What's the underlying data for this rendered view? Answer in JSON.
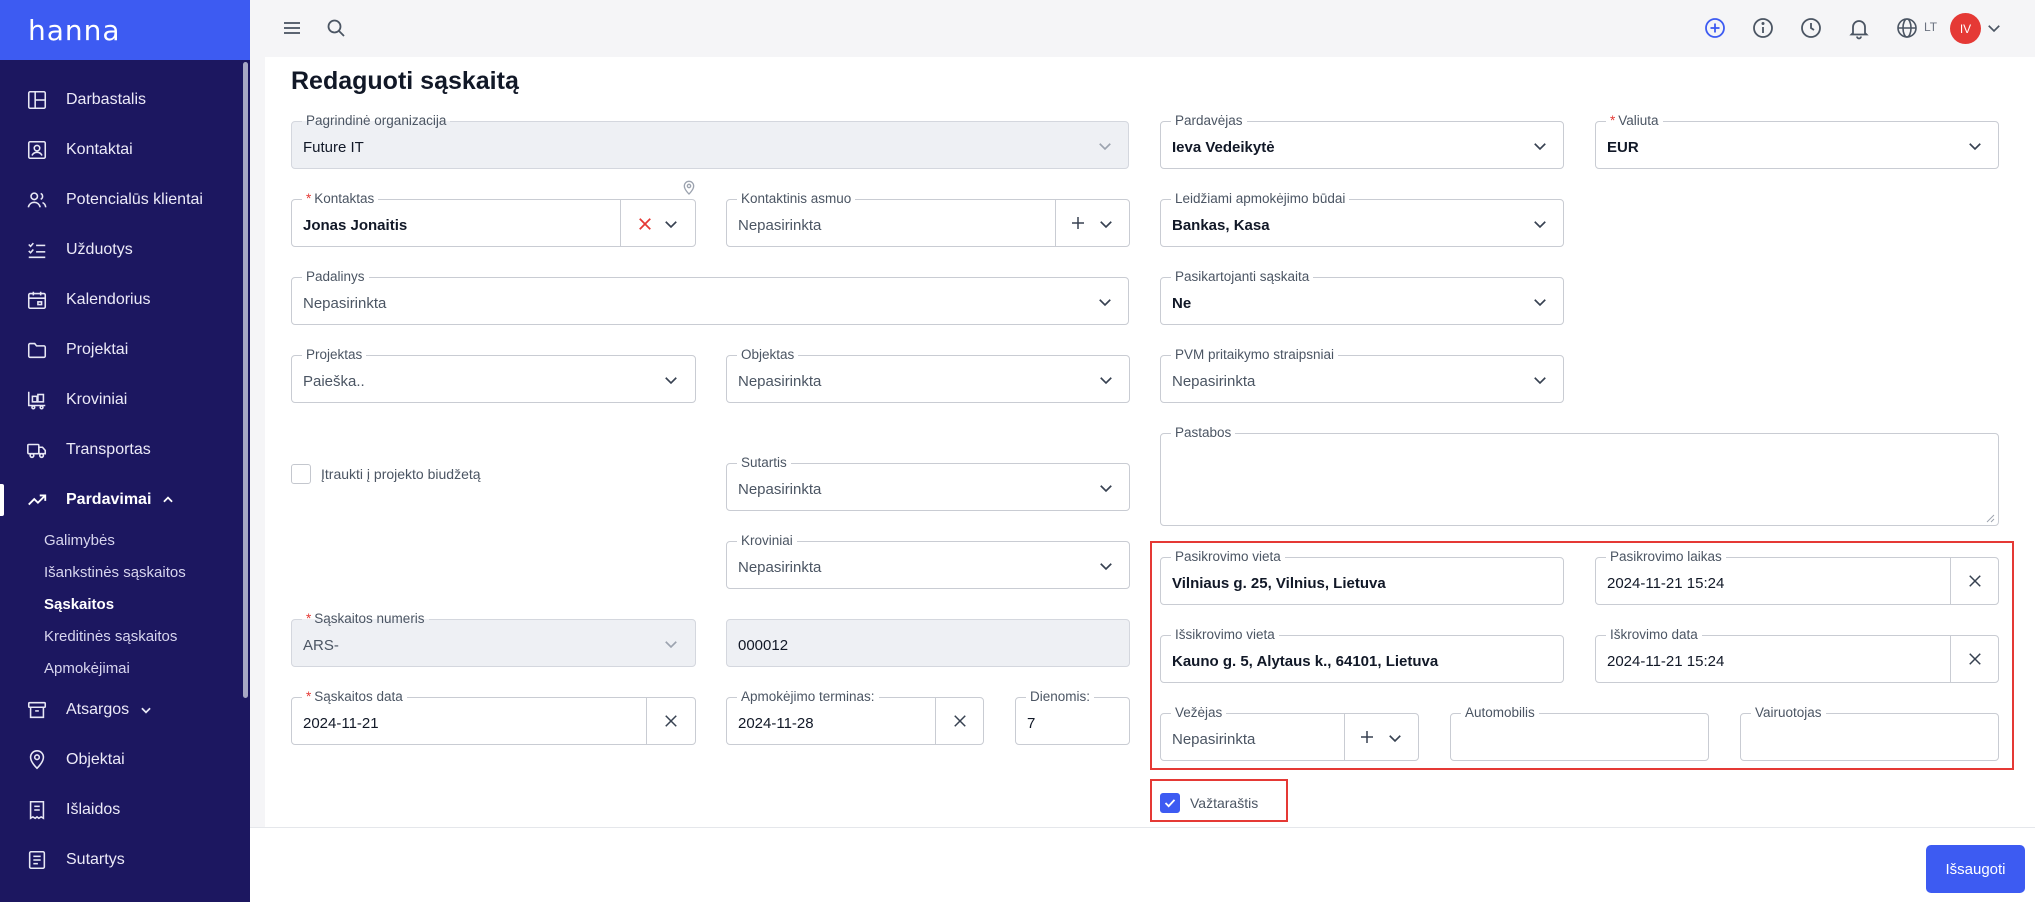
{
  "app": {
    "logo": "hanna"
  },
  "sidebar": {
    "items": [
      {
        "label": "Darbastalis",
        "icon": "dashboard-icon"
      },
      {
        "label": "Kontaktai",
        "icon": "contacts-icon"
      },
      {
        "label": "Potencialūs klientai",
        "icon": "leads-icon"
      },
      {
        "label": "Užduotys",
        "icon": "tasks-icon"
      },
      {
        "label": "Kalendorius",
        "icon": "calendar-icon"
      },
      {
        "label": "Projektai",
        "icon": "folder-icon"
      },
      {
        "label": "Kroviniai",
        "icon": "cargo-icon"
      },
      {
        "label": "Transportas",
        "icon": "truck-icon"
      },
      {
        "label": "Pardavimai",
        "icon": "sales-trend-icon"
      },
      {
        "label": "Atsargos",
        "icon": "box-icon"
      },
      {
        "label": "Objektai",
        "icon": "location-pin-icon"
      },
      {
        "label": "Išlaidos",
        "icon": "receipt-icon"
      },
      {
        "label": "Sutartys",
        "icon": "contract-icon"
      }
    ],
    "sales_sub": [
      "Galimybės",
      "Išankstinės sąskaitos",
      "Sąskaitos",
      "Kreditinės sąskaitos",
      "Apmokėjimai"
    ]
  },
  "topbar": {
    "lang": "LT",
    "avatar_initials": "IV"
  },
  "page": {
    "title": "Redaguoti sąskaitą"
  },
  "form": {
    "parent_org": {
      "label": "Pagrindinė organizacija",
      "value": "Future IT"
    },
    "contact": {
      "label": "Kontaktas",
      "value": "Jonas Jonaitis"
    },
    "contact_person": {
      "label": "Kontaktinis asmuo",
      "value": "Nepasirinkta"
    },
    "division": {
      "label": "Padalinys",
      "value": "Nepasirinkta"
    },
    "project": {
      "label": "Projektas",
      "value": "Paieška.."
    },
    "object": {
      "label": "Objektas",
      "value": "Nepasirinkta"
    },
    "include_budget": {
      "label": "Įtraukti į projekto biudžetą",
      "checked": false
    },
    "contract": {
      "label": "Sutartis",
      "value": "Nepasirinkta"
    },
    "cargo": {
      "label": "Kroviniai",
      "value": "Nepasirinkta"
    },
    "invoice_number": {
      "label": "Sąskaitos numeris",
      "prefix": "ARS-",
      "number": "000012"
    },
    "invoice_date": {
      "label": "Sąskaitos data",
      "value": "2024-11-21"
    },
    "payment_term": {
      "label": "Apmokėjimo terminas:",
      "value": "2024-11-28"
    },
    "days": {
      "label": "Dienomis:",
      "value": "7"
    },
    "seller": {
      "label": "Pardavėjas",
      "value": "Ieva Vedeikytė"
    },
    "currency": {
      "label": "Valiuta",
      "value": "EUR"
    },
    "payment_methods": {
      "label": "Leidžiami apmokėjimo būdai",
      "value": "Bankas, Kasa"
    },
    "recurring": {
      "label": "Pasikartojanti sąskaita",
      "value": "Ne"
    },
    "vat_articles": {
      "label": "PVM pritaikymo straipsniai",
      "value": "Nepasirinkta"
    },
    "notes": {
      "label": "Pastabos",
      "value": ""
    },
    "loading_place": {
      "label": "Pasikrovimo vieta",
      "value": "Vilniaus g. 25, Vilnius, Lietuva"
    },
    "loading_time": {
      "label": "Pasikrovimo laikas",
      "value": "2024-11-21 15:24"
    },
    "unloading_place": {
      "label": "Išsikrovimo vieta",
      "value": "Kauno g. 5, Alytaus k., 64101, Lietuva"
    },
    "unloading_date": {
      "label": "Iškrovimo data",
      "value": "2024-11-21 15:24"
    },
    "carrier": {
      "label": "Vežėjas",
      "value": "Nepasirinkta"
    },
    "vehicle": {
      "label": "Automobilis",
      "value": ""
    },
    "driver": {
      "label": "Vairuotojas",
      "value": ""
    },
    "waybill": {
      "label": "Važtaraštis",
      "checked": true
    }
  },
  "actions": {
    "save": "Išsaugoti"
  },
  "colors": {
    "sidebar": "#1c1760",
    "accent": "#3d5bf2",
    "danger": "#e53935"
  }
}
